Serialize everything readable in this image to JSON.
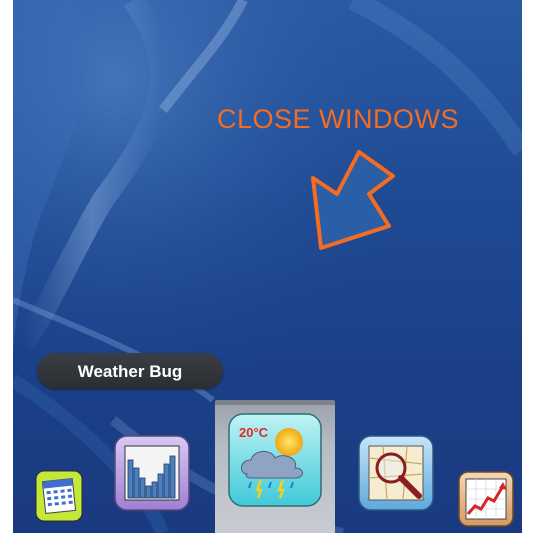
{
  "annotation": {
    "caption": "CLOSE WINDOWS"
  },
  "tooltip": {
    "label": "Weather Bug"
  },
  "dock": {
    "items": [
      {
        "name": "calendar",
        "icon": "calendar-icon"
      },
      {
        "name": "stock-chart",
        "icon": "bar-chart-icon"
      },
      {
        "name": "weather-bug",
        "icon": "weather-icon",
        "active": true,
        "temperature": "20°C"
      },
      {
        "name": "map-search",
        "icon": "map-search-icon"
      },
      {
        "name": "stocks",
        "icon": "line-chart-icon"
      }
    ]
  },
  "colors": {
    "caption": "#f36c21",
    "desktop_blue": "#1f4b94",
    "tooltip_bg": "#2e3136"
  }
}
